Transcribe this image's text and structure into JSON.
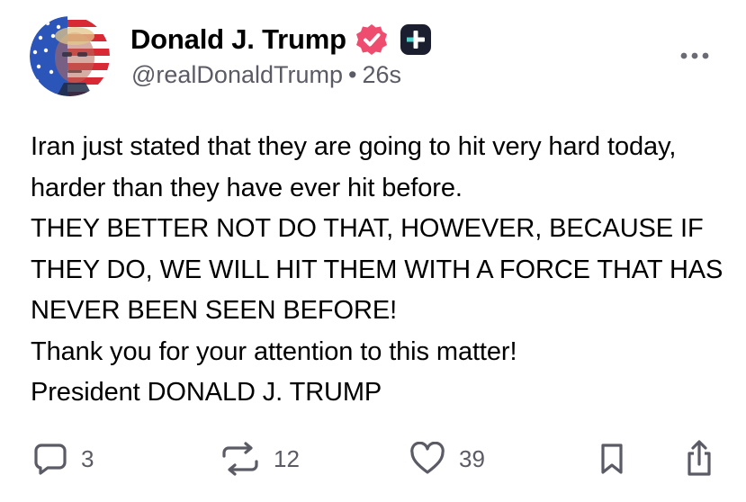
{
  "post": {
    "author": {
      "display_name": "Donald J. Trump",
      "handle": "@realDonaldTrump",
      "separator": "•",
      "timestamp": "26s",
      "verified_icon": "verified-check-icon",
      "plus_icon": "plus-badge-icon",
      "avatar_icon": "avatar-flag-portrait"
    },
    "body": "Iran just stated that they are going to hit very hard today, harder than they have ever hit before.\nTHEY BETTER NOT DO THAT, HOWEVER, BECAUSE IF THEY DO, WE WILL HIT THEM WITH A FORCE THAT HAS NEVER BEEN SEEN BEFORE!\nThank you for your attention to this matter!\nPresident DONALD J. TRUMP",
    "actions": {
      "reply": {
        "icon": "reply-icon",
        "count": "3"
      },
      "repost": {
        "icon": "repost-icon",
        "count": "12"
      },
      "like": {
        "icon": "heart-icon",
        "count": "39"
      },
      "bookmark": {
        "icon": "bookmark-icon"
      },
      "share": {
        "icon": "share-icon"
      },
      "more": {
        "icon": "more-dots-icon"
      }
    }
  },
  "colors": {
    "text": "#000000",
    "secondary_text": "#5b5b66",
    "verified": "#ee4d6f",
    "plus_badge": "#1a1e2e",
    "background": "#ffffff"
  }
}
